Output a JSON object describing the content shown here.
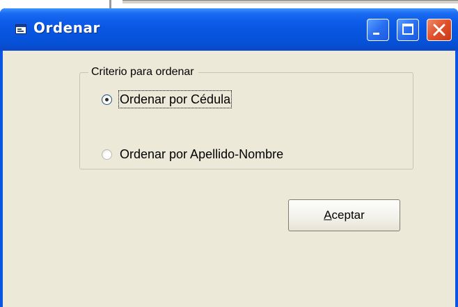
{
  "window": {
    "title": "Ordenar",
    "icon": "form-icon",
    "controls": [
      "minimize-icon",
      "maximize-icon",
      "close-icon"
    ]
  },
  "group": {
    "legend": "Criterio para ordenar",
    "options": [
      {
        "label": "Ordenar por Cédula",
        "selected": true
      },
      {
        "label": "Ordenar por Apellido-Nombre",
        "selected": false
      }
    ]
  },
  "buttons": {
    "accept_mnemonic": "A",
    "accept_rest": "ceptar"
  },
  "colors": {
    "titlebar": "#0a58e6",
    "client": "#ece9d8",
    "close_button": "#e0502a"
  }
}
